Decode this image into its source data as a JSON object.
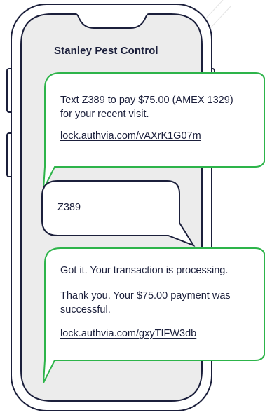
{
  "sender": {
    "name": "Stanley Pest Control"
  },
  "messages": [
    {
      "direction": "incoming",
      "lines": [
        "Text Z389 to pay $75.00 (AMEX 1329)",
        "for your recent visit."
      ],
      "link": "lock.authvia.com/vAXrK1G07m"
    },
    {
      "direction": "outgoing",
      "text": "Z389"
    },
    {
      "direction": "incoming",
      "line1": "Got it. Your transaction is processing.",
      "lines": [
        "Thank you. Your $75.00 payment was",
        "successful."
      ],
      "link": "lock.authvia.com/gxyTIFW3db"
    }
  ],
  "colors": {
    "outline": "#1b1f3b",
    "accent": "#2db44a",
    "screen": "#ececec",
    "text": "#1b1f3b"
  }
}
